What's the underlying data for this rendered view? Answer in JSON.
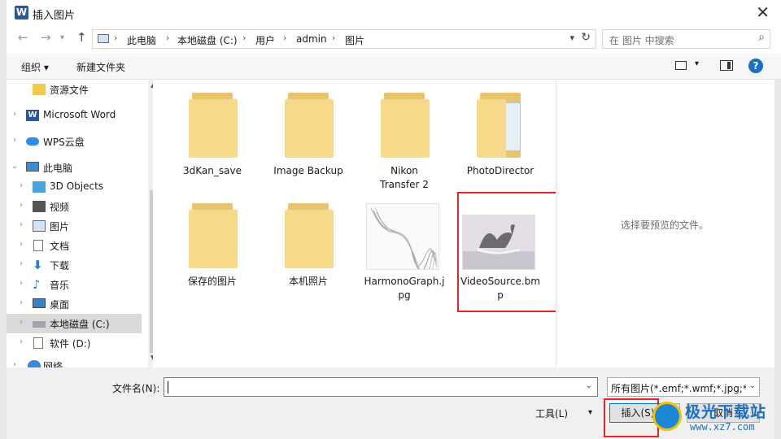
{
  "window": {
    "title": "插入图片",
    "app_icon_letter": "W"
  },
  "address": {
    "crumbs": [
      "此电脑",
      "本地磁盘 (C:)",
      "用户",
      "admin",
      "图片"
    ],
    "search_placeholder": "在 图片 中搜索"
  },
  "toolbar": {
    "organize": "组织 ▾",
    "new_folder": "新建文件夹",
    "help": "?"
  },
  "sidebar": {
    "items": [
      {
        "label": "资源文件",
        "icon": "folder-icon"
      },
      {
        "label": "Microsoft Word",
        "icon": "word-icon"
      },
      {
        "label": "WPS云盘",
        "icon": "cloud-icon"
      },
      {
        "label": "此电脑",
        "icon": "computer-icon"
      },
      {
        "label": "3D Objects",
        "icon": "3d-icon"
      },
      {
        "label": "视频",
        "icon": "video-icon"
      },
      {
        "label": "图片",
        "icon": "pictures-icon"
      },
      {
        "label": "文档",
        "icon": "documents-icon"
      },
      {
        "label": "下载",
        "icon": "download-icon"
      },
      {
        "label": "音乐",
        "icon": "music-icon"
      },
      {
        "label": "桌面",
        "icon": "desktop-icon"
      },
      {
        "label": "本地磁盘 (C:)",
        "icon": "drive-icon"
      },
      {
        "label": "软件 (D:)",
        "icon": "drive-icon"
      },
      {
        "label": "网络",
        "icon": "network-icon"
      }
    ]
  },
  "files": [
    {
      "name": "3dKan_save",
      "kind": "folder"
    },
    {
      "name": "Image Backup",
      "kind": "folder"
    },
    {
      "name": "Nikon Transfer 2",
      "kind": "folder"
    },
    {
      "name": "PhotoDirector",
      "kind": "folder"
    },
    {
      "name": "保存的图片",
      "kind": "folder"
    },
    {
      "name": "本机照片",
      "kind": "folder"
    },
    {
      "name": "HarmonoGraph.jpg",
      "kind": "image"
    },
    {
      "name": "VideoSource.bmp",
      "kind": "image"
    }
  ],
  "preview": {
    "empty_text": "选择要预览的文件。"
  },
  "bottom": {
    "filename_label": "文件名(N):",
    "filename_value": "",
    "filetype": "所有图片(*.emf;*.wmf;*.jpg;*.jpeg",
    "tools": "工具(L)",
    "insert": "插入(S)",
    "cancel": "取消"
  },
  "watermark": {
    "cn": "极光下载站",
    "url": "www.xz7.com"
  },
  "colors": {
    "accent": "#0078d7",
    "highlight": "#e0262a",
    "folder": "#f7d98a"
  }
}
